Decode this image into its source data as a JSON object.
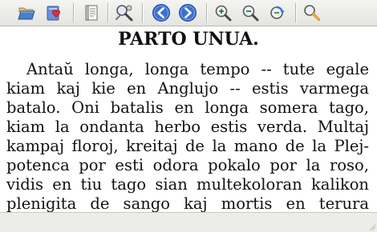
{
  "toolbar": {
    "buttons": [
      {
        "id": "open",
        "icon": "folder-open-icon"
      },
      {
        "id": "bookmark",
        "icon": "bookmark-heart-icon"
      },
      {
        "id": "contents",
        "icon": "book-contents-icon"
      },
      {
        "id": "settings",
        "icon": "tools-icon"
      },
      {
        "id": "back",
        "icon": "arrow-left-icon"
      },
      {
        "id": "forward",
        "icon": "arrow-right-icon"
      },
      {
        "id": "zoom_in",
        "icon": "zoom-in-icon"
      },
      {
        "id": "zoom_out",
        "icon": "zoom-out-icon"
      },
      {
        "id": "rotate",
        "icon": "rotate-icon"
      },
      {
        "id": "search",
        "icon": "search-wrench-icon"
      }
    ],
    "colors": {
      "arrow_blue": "#3b6fd4",
      "folder_blue": "#4a7fd0",
      "heart_red": "#e0303a"
    }
  },
  "document": {
    "chapter_title": "PARTO UNUA.",
    "lines": [
      "Antaŭ longa, longa tempo -- tute egale",
      "kiam kaj kie en Anglujo -- estis varmega",
      "batalo. Oni batalis en longa somera tago,",
      "kiam la ondanta herbo estis verda. Multaj",
      "kampaj floroj, kreitaj de la mano de la Plej-",
      "potenca por esti odora pokalo por la roso,",
      "vidis en tiu tago sian multekoloran kalikon",
      "plenigita de sango kaj mortis en terura"
    ]
  }
}
